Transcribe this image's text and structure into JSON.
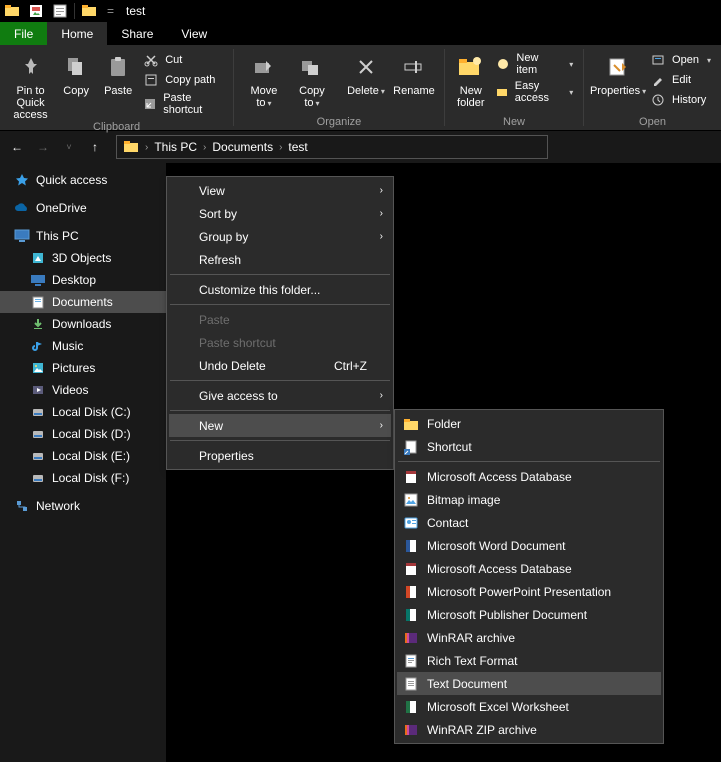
{
  "title": "test",
  "tabs": {
    "file": "File",
    "home": "Home",
    "share": "Share",
    "view": "View"
  },
  "ribbon": {
    "clipboard": {
      "label": "Clipboard",
      "pin": "Pin to Quick\naccess",
      "copy": "Copy",
      "paste": "Paste",
      "cut": "Cut",
      "copypath": "Copy path",
      "pasteshortcut": "Paste shortcut"
    },
    "organize": {
      "label": "Organize",
      "moveto": "Move\nto",
      "copyto": "Copy\nto",
      "delete": "Delete",
      "rename": "Rename"
    },
    "new": {
      "label": "New",
      "newfolder": "New\nfolder",
      "newitem": "New item",
      "easyaccess": "Easy access"
    },
    "open": {
      "label": "Open",
      "properties": "Properties",
      "open": "Open",
      "edit": "Edit",
      "history": "History"
    }
  },
  "breadcrumbs": [
    "This PC",
    "Documents",
    "test"
  ],
  "sidebar": {
    "quickaccess": "Quick access",
    "onedrive": "OneDrive",
    "thispc": "This PC",
    "items": [
      "3D Objects",
      "Desktop",
      "Documents",
      "Downloads",
      "Music",
      "Pictures",
      "Videos",
      "Local Disk (C:)",
      "Local Disk (D:)",
      "Local Disk (E:)",
      "Local Disk (F:)"
    ],
    "network": "Network"
  },
  "ctx": {
    "view": "View",
    "sortby": "Sort by",
    "groupby": "Group by",
    "refresh": "Refresh",
    "customize": "Customize this folder...",
    "paste": "Paste",
    "pastesc": "Paste shortcut",
    "undo": "Undo Delete",
    "undok": "Ctrl+Z",
    "giveaccess": "Give access to",
    "new": "New",
    "properties": "Properties"
  },
  "newmenu": [
    "Folder",
    "Shortcut",
    "Microsoft Access Database",
    "Bitmap image",
    "Contact",
    "Microsoft Word Document",
    "Microsoft Access Database",
    "Microsoft PowerPoint Presentation",
    "Microsoft Publisher Document",
    "WinRAR archive",
    "Rich Text Format",
    "Text Document",
    "Microsoft Excel Worksheet",
    "WinRAR ZIP archive"
  ]
}
